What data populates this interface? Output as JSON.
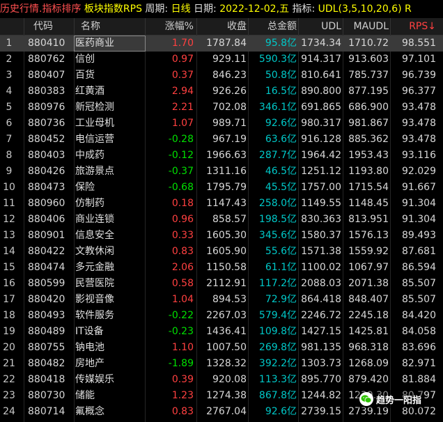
{
  "titlebar": {
    "module": "历史行情.指标排序",
    "board_label": "板块指数RPS",
    "period_label": "周期:",
    "period_value": "日线",
    "date_label": "日期:",
    "date_value": "2022-12-02,五",
    "indicator_label": "指标:",
    "indicator_value": "UDL(3,5,10,20,6)",
    "overflow": "R"
  },
  "columns": {
    "code": "代码",
    "name": "名称",
    "change": "涨幅%",
    "close": "收盘",
    "amount": "总金额",
    "udl": "UDL",
    "maudl": "MAUDL",
    "rps": "RPS↓"
  },
  "rows": [
    {
      "idx": "1",
      "code": "880410",
      "name": "医药商业",
      "change": "1.70",
      "dir": "up",
      "close": "1787.84",
      "amount": "95.8亿",
      "udl": "1734.34",
      "maudl": "1710.72",
      "rps": "98.551"
    },
    {
      "idx": "2",
      "code": "880762",
      "name": "信创",
      "change": "0.97",
      "dir": "up",
      "close": "929.11",
      "amount": "590.3亿",
      "udl": "914.317",
      "maudl": "913.603",
      "rps": "97.101"
    },
    {
      "idx": "3",
      "code": "880407",
      "name": "百货",
      "change": "0.37",
      "dir": "up",
      "close": "846.23",
      "amount": "50.8亿",
      "udl": "810.641",
      "maudl": "785.737",
      "rps": "96.739"
    },
    {
      "idx": "4",
      "code": "880383",
      "name": "红黄酒",
      "change": "2.94",
      "dir": "up",
      "close": "926.26",
      "amount": "16.5亿",
      "udl": "890.800",
      "maudl": "877.195",
      "rps": "96.377"
    },
    {
      "idx": "5",
      "code": "880976",
      "name": "新冠检测",
      "change": "2.21",
      "dir": "up",
      "close": "702.08",
      "amount": "346.1亿",
      "udl": "691.865",
      "maudl": "686.900",
      "rps": "93.478"
    },
    {
      "idx": "6",
      "code": "880736",
      "name": "工业母机",
      "change": "1.07",
      "dir": "up",
      "close": "989.71",
      "amount": "92.6亿",
      "udl": "980.317",
      "maudl": "981.867",
      "rps": "93.478"
    },
    {
      "idx": "7",
      "code": "880452",
      "name": "电信运营",
      "change": "-0.28",
      "dir": "down",
      "close": "967.19",
      "amount": "63.6亿",
      "udl": "916.128",
      "maudl": "885.362",
      "rps": "93.478"
    },
    {
      "idx": "8",
      "code": "880403",
      "name": "中成药",
      "change": "-0.12",
      "dir": "down",
      "close": "1966.63",
      "amount": "287.7亿",
      "udl": "1964.42",
      "maudl": "1953.43",
      "rps": "93.116"
    },
    {
      "idx": "9",
      "code": "880426",
      "name": "旅游景点",
      "change": "-0.37",
      "dir": "down",
      "close": "1311.16",
      "amount": "46.5亿",
      "udl": "1251.12",
      "maudl": "1193.80",
      "rps": "92.029"
    },
    {
      "idx": "10",
      "code": "880473",
      "name": "保险",
      "change": "-0.68",
      "dir": "down",
      "close": "1795.79",
      "amount": "45.5亿",
      "udl": "1757.00",
      "maudl": "1715.54",
      "rps": "91.667"
    },
    {
      "idx": "11",
      "code": "880960",
      "name": "仿制药",
      "change": "0.18",
      "dir": "up",
      "close": "1147.43",
      "amount": "258.0亿",
      "udl": "1149.55",
      "maudl": "1148.45",
      "rps": "91.304"
    },
    {
      "idx": "12",
      "code": "880406",
      "name": "商业连锁",
      "change": "0.96",
      "dir": "up",
      "close": "858.57",
      "amount": "198.5亿",
      "udl": "830.363",
      "maudl": "813.951",
      "rps": "91.304"
    },
    {
      "idx": "13",
      "code": "880901",
      "name": "信息安全",
      "change": "0.33",
      "dir": "up",
      "close": "1605.30",
      "amount": "345.6亿",
      "udl": "1580.37",
      "maudl": "1576.13",
      "rps": "89.493"
    },
    {
      "idx": "14",
      "code": "880422",
      "name": "文教休闲",
      "change": "0.83",
      "dir": "up",
      "close": "1605.90",
      "amount": "55.6亿",
      "udl": "1571.38",
      "maudl": "1559.92",
      "rps": "87.681"
    },
    {
      "idx": "15",
      "code": "880474",
      "name": "多元金融",
      "change": "2.06",
      "dir": "up",
      "close": "1150.58",
      "amount": "61.1亿",
      "udl": "1100.02",
      "maudl": "1067.97",
      "rps": "86.594"
    },
    {
      "idx": "16",
      "code": "880599",
      "name": "民营医院",
      "change": "0.58",
      "dir": "up",
      "close": "2112.91",
      "amount": "117.2亿",
      "udl": "2088.03",
      "maudl": "2071.38",
      "rps": "85.507"
    },
    {
      "idx": "17",
      "code": "880420",
      "name": "影视音像",
      "change": "1.04",
      "dir": "up",
      "close": "894.53",
      "amount": "72.9亿",
      "udl": "864.418",
      "maudl": "848.407",
      "rps": "85.507"
    },
    {
      "idx": "18",
      "code": "880493",
      "name": "软件服务",
      "change": "-0.22",
      "dir": "down",
      "close": "2267.03",
      "amount": "579.4亿",
      "udl": "2246.72",
      "maudl": "2245.18",
      "rps": "84.420"
    },
    {
      "idx": "19",
      "code": "880489",
      "name": "IT设备",
      "change": "-0.23",
      "dir": "down",
      "close": "1436.41",
      "amount": "109.8亿",
      "udl": "1427.15",
      "maudl": "1425.81",
      "rps": "84.058"
    },
    {
      "idx": "20",
      "code": "880755",
      "name": "钠电池",
      "change": "1.10",
      "dir": "up",
      "close": "1007.50",
      "amount": "269.8亿",
      "udl": "981.135",
      "maudl": "968.318",
      "rps": "83.696"
    },
    {
      "idx": "21",
      "code": "880482",
      "name": "房地产",
      "change": "-1.89",
      "dir": "down",
      "close": "1328.32",
      "amount": "392.2亿",
      "udl": "1303.73",
      "maudl": "1268.09",
      "rps": "82.971"
    },
    {
      "idx": "22",
      "code": "880418",
      "name": "传媒娱乐",
      "change": "0.39",
      "dir": "up",
      "close": "920.08",
      "amount": "113.3亿",
      "udl": "895.770",
      "maudl": "879.420",
      "rps": "81.884"
    },
    {
      "idx": "23",
      "code": "880730",
      "name": "储能",
      "change": "1.23",
      "dir": "up",
      "close": "1274.38",
      "amount": "867.8亿",
      "udl": "1244.82",
      "maudl": "1239.30",
      "rps": "80.797"
    },
    {
      "idx": "24",
      "code": "880714",
      "name": "氟概念",
      "change": "0.83",
      "dir": "up",
      "close": "2767.04",
      "amount": "92.6亿",
      "udl": "2739.15",
      "maudl": "2739.19",
      "rps": "80.072"
    }
  ],
  "watermark": {
    "text": "趋势一阳指",
    "icon": "wechat-icon"
  },
  "colors": {
    "up": "#ff4040",
    "down": "#00e000",
    "amount": "#00c8c8",
    "title_red": "#ff5050",
    "title_yellow": "#ffff00"
  }
}
